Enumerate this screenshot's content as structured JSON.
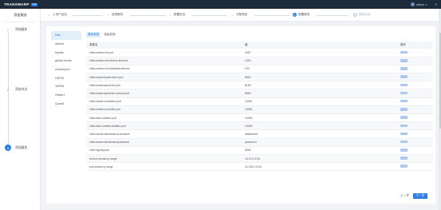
{
  "topbar": {
    "logo": "TRANSWARP",
    "badge": "CDH",
    "user": "admin"
  },
  "sidebar": {
    "title": "添加服务",
    "steps": [
      {
        "label": "添加服务",
        "state": "done"
      },
      {
        "label": "添加节点",
        "state": "done"
      },
      {
        "label": "添加服务",
        "state": "active",
        "num": "3"
      }
    ]
  },
  "steps": [
    {
      "label": "上传产品包",
      "state": "done",
      "num": "✓"
    },
    {
      "label": "选择服务",
      "state": "done",
      "num": "✓"
    },
    {
      "label": "配置安全",
      "state": "done",
      "num": "✓"
    },
    {
      "label": "分配角色",
      "state": "done",
      "num": "✓"
    },
    {
      "label": "配置服务",
      "state": "active",
      "num": "5"
    },
    {
      "label": "服务启动",
      "state": "pending",
      "num": "6"
    }
  ],
  "services": [
    "hdfs",
    "license",
    "keytab",
    "global-hunds",
    "Zookeeper1",
    "HDFS1",
    "YARN1",
    "Hbase1",
    "Quant1"
  ],
  "tabs": [
    "基础参数",
    "高级参数"
  ],
  "table": {
    "headers": [
      "参数名",
      "值",
      "操作"
    ],
    "rows": [
      [
        "hdfs.master.rmi.port",
        "4057",
        ""
      ],
      [
        "hdfs.master.rmi.election.timeout",
        "1200",
        ""
      ],
      [
        "hdfs.master.rmi.heartbeat.interval",
        "200",
        ""
      ],
      [
        "hdfs.master.leader.elect.port",
        "8992",
        ""
      ],
      [
        "hdfs.master.apiserver.port",
        "8180",
        ""
      ],
      [
        "hdfs.master.apiserver.secure.port",
        "8553",
        ""
      ],
      [
        "hdfs.master.scheduler.port",
        "10251",
        ""
      ],
      [
        "hdfs.master.controller.port",
        "10252",
        ""
      ],
      [
        "hdfs.slave.kubelet.port",
        "10250",
        ""
      ],
      [
        "hdfs.slave.kubelet.healthz.port",
        "10248",
        ""
      ],
      [
        "hdfs.master.dashboard.username",
        "dashboard",
        ""
      ],
      [
        "hdfs.master.dashboard.password",
        "password",
        ""
      ],
      [
        "hdfs.registry.port",
        "5000",
        ""
      ],
      [
        "service.cluster.ip.range",
        "10.10.0.0/16",
        ""
      ],
      [
        "pod.cluster.ip.range",
        "10.224.0.0/16",
        ""
      ]
    ]
  },
  "footer": {
    "prev": "上一步",
    "next": "下一步"
  }
}
